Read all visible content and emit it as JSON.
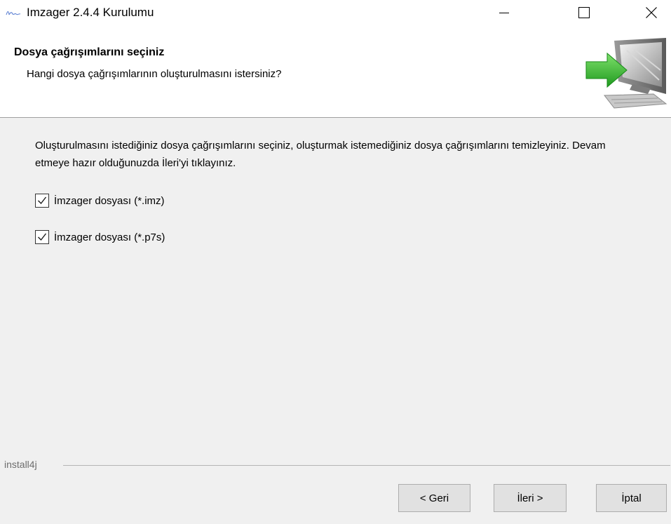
{
  "window": {
    "title": "Imzager 2.4.4 Kurulumu",
    "app_icon": "imzager-signature-icon",
    "controls": {
      "minimize_icon": "minimize-icon",
      "maximize_icon": "maximize-icon",
      "close_icon": "close-icon"
    }
  },
  "header": {
    "title": "Dosya çağrışımlarını seçiniz",
    "subtitle": "Hangi dosya çağrışımlarının oluşturulmasını istersiniz?",
    "graphic": "computer-with-green-arrow-icon"
  },
  "body": {
    "description": "Oluşturulmasını istediğiniz dosya çağrışımlarını seçiniz, oluşturmak istemediğiniz dosya çağrışımlarını temizleyiniz. Devam etmeye hazır olduğunuzda İleri'yi tıklayınız.",
    "associations": [
      {
        "label": "İmzager dosyası (*.imz)",
        "checked": true
      },
      {
        "label": "İmzager dosyası (*.p7s)",
        "checked": true
      }
    ]
  },
  "footer": {
    "brand": "install4j",
    "buttons": {
      "back": "< Geri",
      "next": "İleri >",
      "cancel": "İptal"
    }
  },
  "colors": {
    "window_bg": "#f0f0f0",
    "header_bg": "#ffffff",
    "button_bg": "#e1e1e1",
    "button_border": "#adadad",
    "arrow_green": "#3dbb3a"
  }
}
